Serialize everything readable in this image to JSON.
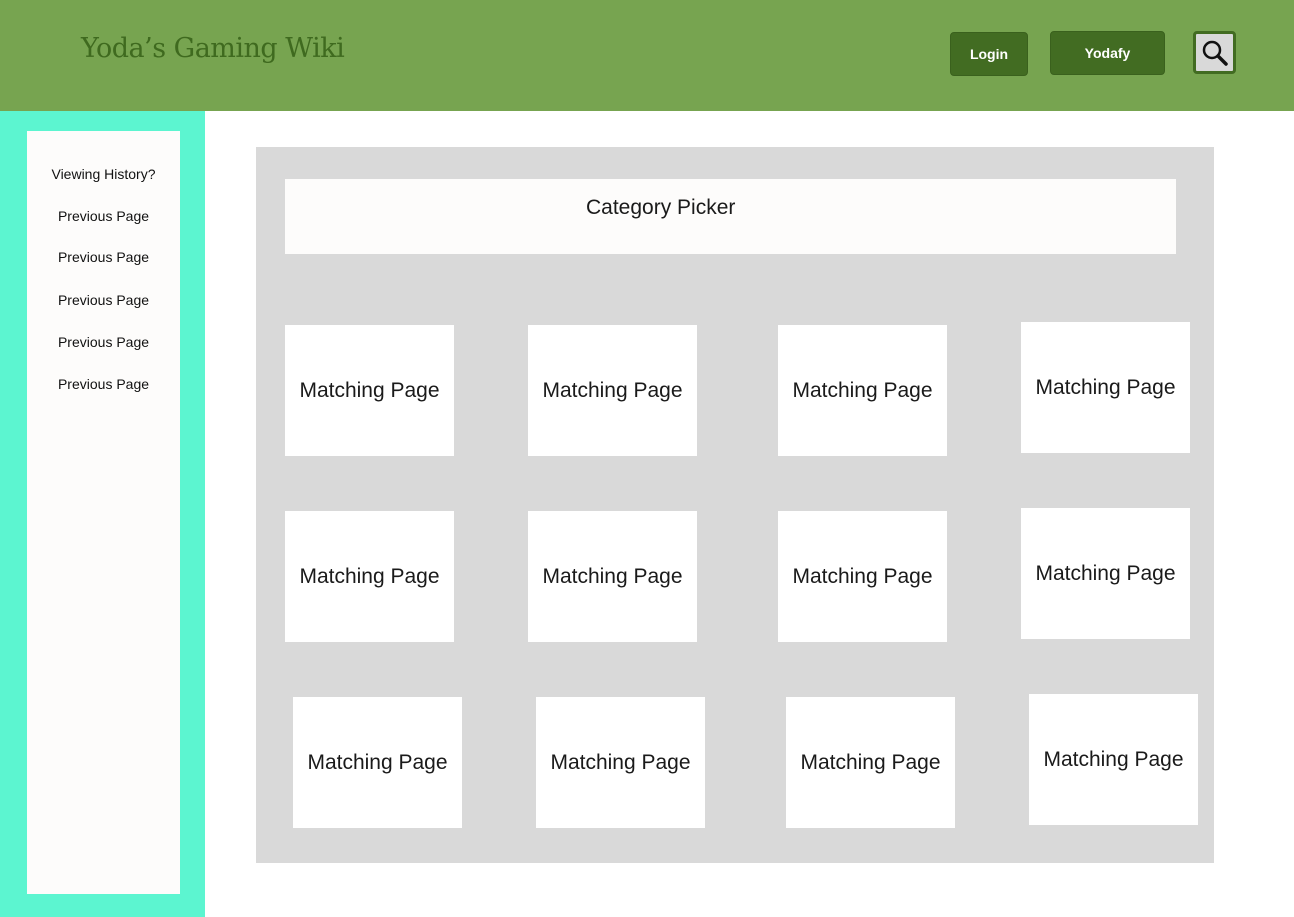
{
  "header": {
    "site_title": "Yoda’s Gaming Wiki",
    "login_label": "Login",
    "yodafy_label": "Yodafy",
    "search_icon": "magnifier-icon",
    "bg_color": "#77a450",
    "button_color": "#426c22"
  },
  "sidebar": {
    "bg_color": "#5cf5d0",
    "items": [
      {
        "label": "Viewing History?"
      },
      {
        "label": "Previous Page"
      },
      {
        "label": "Previous Page"
      },
      {
        "label": "Previous Page"
      },
      {
        "label": "Previous Page"
      },
      {
        "label": "Previous Page"
      }
    ]
  },
  "main": {
    "category_picker_label": "Category Picker",
    "cards": [
      {
        "label": "Matching Page"
      },
      {
        "label": "Matching Page"
      },
      {
        "label": "Matching Page"
      },
      {
        "label": "Matching Page"
      },
      {
        "label": "Matching Page"
      },
      {
        "label": "Matching Page"
      },
      {
        "label": "Matching Page"
      },
      {
        "label": "Matching Page"
      },
      {
        "label": "Matching Page"
      },
      {
        "label": "Matching Page"
      },
      {
        "label": "Matching Page"
      },
      {
        "label": "Matching Page"
      }
    ]
  }
}
